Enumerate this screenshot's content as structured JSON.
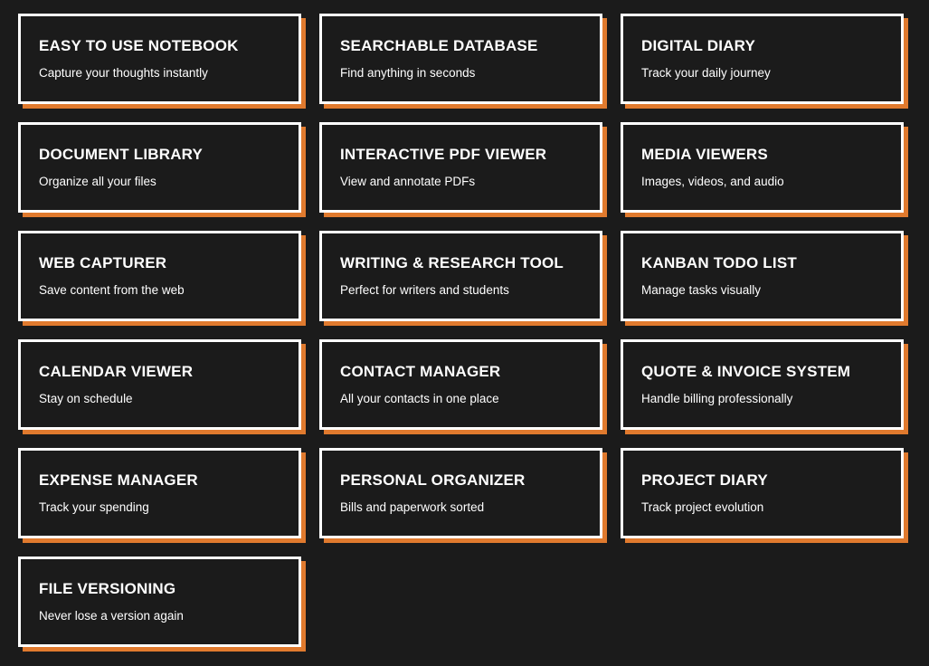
{
  "colors": {
    "background": "#1b1b1b",
    "card_border": "#ffffff",
    "card_shadow_accent": "#e07a2e",
    "text": "#ffffff"
  },
  "features": [
    {
      "title": "EASY TO USE NOTEBOOK",
      "description": "Capture your thoughts instantly"
    },
    {
      "title": "SEARCHABLE DATABASE",
      "description": "Find anything in seconds"
    },
    {
      "title": "DIGITAL DIARY",
      "description": "Track your daily journey"
    },
    {
      "title": "DOCUMENT LIBRARY",
      "description": "Organize all your files"
    },
    {
      "title": "INTERACTIVE PDF VIEWER",
      "description": "View and annotate PDFs"
    },
    {
      "title": "MEDIA VIEWERS",
      "description": "Images, videos, and audio"
    },
    {
      "title": "WEB CAPTURER",
      "description": "Save content from the web"
    },
    {
      "title": "WRITING & RESEARCH TOOL",
      "description": "Perfect for writers and students"
    },
    {
      "title": "KANBAN TODO LIST",
      "description": "Manage tasks visually"
    },
    {
      "title": "CALENDAR VIEWER",
      "description": "Stay on schedule"
    },
    {
      "title": "CONTACT MANAGER",
      "description": "All your contacts in one place"
    },
    {
      "title": "QUOTE & INVOICE SYSTEM",
      "description": "Handle billing professionally"
    },
    {
      "title": "EXPENSE MANAGER",
      "description": "Track your spending"
    },
    {
      "title": "PERSONAL ORGANIZER",
      "description": "Bills and paperwork sorted"
    },
    {
      "title": "PROJECT DIARY",
      "description": "Track project evolution"
    },
    {
      "title": "FILE VERSIONING",
      "description": "Never lose a version again"
    }
  ]
}
